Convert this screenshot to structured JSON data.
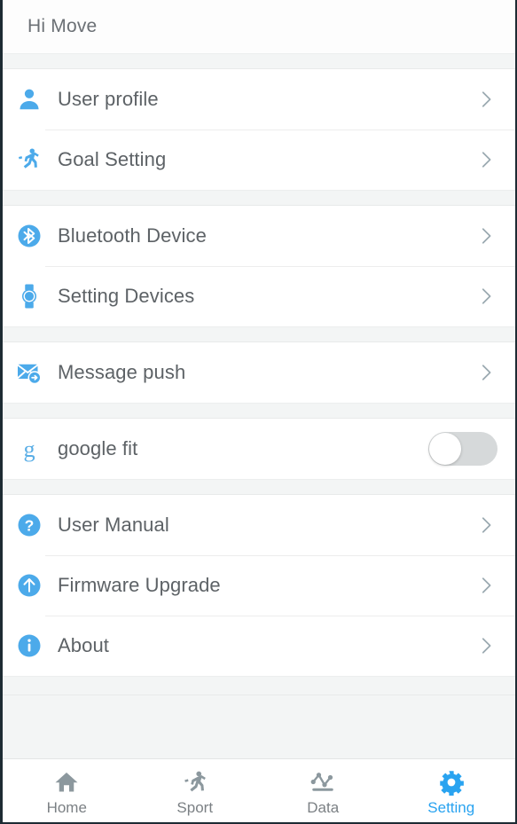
{
  "header": {
    "title": "Hi Move"
  },
  "colors": {
    "accent": "#4caaea",
    "accent_active": "#29a3f0",
    "icon_gray": "#8c989e",
    "text": "#5d6266",
    "toggle_off_track": "#d6d9da",
    "background": "#f3f5f5",
    "card": "#ffffff"
  },
  "sections": [
    {
      "name": "profile",
      "rows": [
        {
          "label": "User profile",
          "icon": "user-icon",
          "accessory": "chevron"
        },
        {
          "label": "Goal Setting",
          "icon": "runner-icon",
          "accessory": "chevron"
        }
      ]
    },
    {
      "name": "devices",
      "rows": [
        {
          "label": "Bluetooth Device",
          "icon": "bluetooth-icon",
          "accessory": "chevron"
        },
        {
          "label": "Setting Devices",
          "icon": "watch-icon",
          "accessory": "chevron"
        }
      ]
    },
    {
      "name": "notifications",
      "rows": [
        {
          "label": "Message push",
          "icon": "message-push-icon",
          "accessory": "chevron"
        }
      ]
    },
    {
      "name": "integrations",
      "rows": [
        {
          "label": "google fit",
          "icon": "google-fit-icon",
          "accessory": "toggle",
          "toggle_on": false
        }
      ]
    },
    {
      "name": "support",
      "rows": [
        {
          "label": "User Manual",
          "icon": "help-icon",
          "accessory": "chevron"
        },
        {
          "label": "Firmware Upgrade",
          "icon": "upgrade-icon",
          "accessory": "chevron"
        },
        {
          "label": "About",
          "icon": "info-icon",
          "accessory": "chevron"
        }
      ]
    }
  ],
  "tabbar": {
    "tabs": [
      {
        "label": "Home",
        "icon": "home-icon",
        "active": false
      },
      {
        "label": "Sport",
        "icon": "sport-icon",
        "active": false
      },
      {
        "label": "Data",
        "icon": "data-icon",
        "active": false
      },
      {
        "label": "Setting",
        "icon": "gear-icon",
        "active": true
      }
    ]
  }
}
